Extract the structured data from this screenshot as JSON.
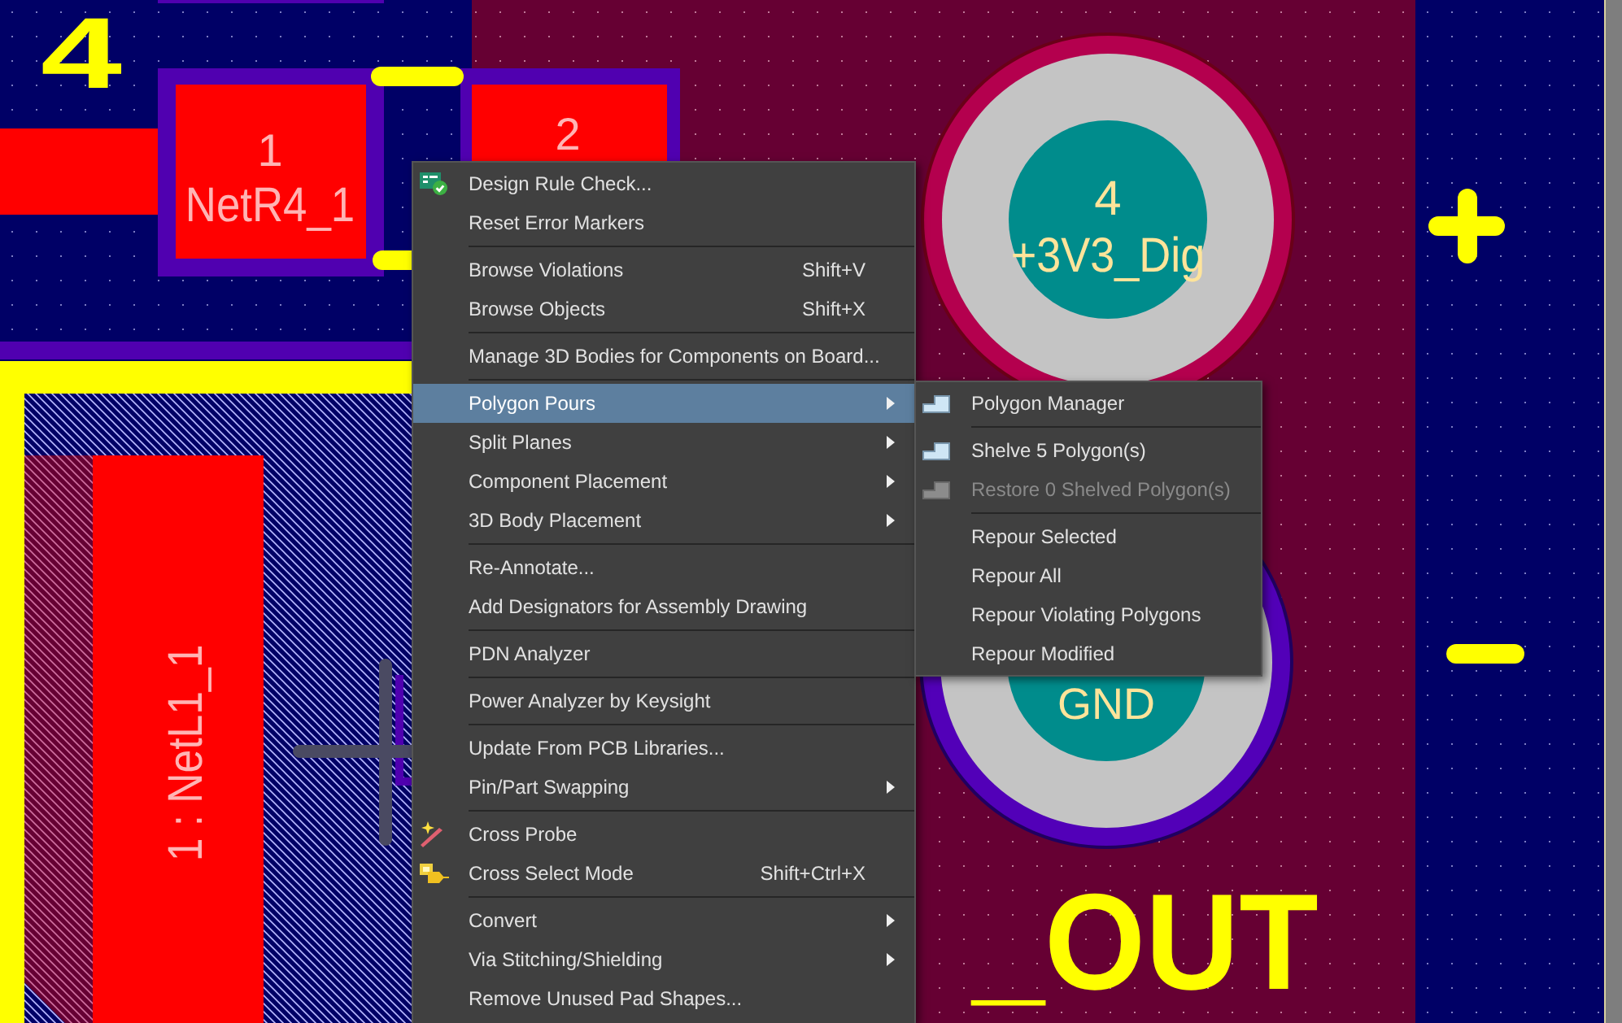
{
  "pcb": {
    "designator": "4",
    "silkscreen_label": "_OUT",
    "pads": [
      {
        "kind": "smd",
        "number": "1",
        "net": "NetR4_1"
      },
      {
        "kind": "smd",
        "number": "2"
      },
      {
        "kind": "smd-vertical",
        "label": "1 : NetL1_1"
      },
      {
        "kind": "through-hole",
        "number": "4",
        "net": "+3V3_Dig"
      },
      {
        "kind": "through-hole",
        "net": "GND"
      }
    ]
  },
  "context_menu": {
    "sections": [
      [
        {
          "label": "Design Rule Check...",
          "kind": "check",
          "submenu": false,
          "selected": false
        },
        {
          "label": "Reset Error Markers",
          "kind": "plain",
          "submenu": false,
          "selected": false
        }
      ],
      [
        {
          "label": "Browse Violations",
          "shortcut": "Shift+V",
          "kind": "plain",
          "submenu": false,
          "selected": false
        },
        {
          "label": "Browse Objects",
          "shortcut": "Shift+X",
          "kind": "plain",
          "submenu": false,
          "selected": false
        }
      ],
      [
        {
          "label": "Manage 3D Bodies for Components on Board...",
          "kind": "plain",
          "submenu": false,
          "selected": false
        }
      ],
      [
        {
          "label": "Polygon Pours",
          "kind": "plain",
          "submenu": true,
          "selected": true
        },
        {
          "label": "Split Planes",
          "kind": "plain",
          "submenu": true,
          "selected": false
        },
        {
          "label": "Component Placement",
          "kind": "plain",
          "submenu": true,
          "selected": false
        },
        {
          "label": "3D Body Placement",
          "kind": "plain",
          "submenu": true,
          "selected": false
        }
      ],
      [
        {
          "label": "Re-Annotate...",
          "kind": "plain",
          "submenu": false,
          "selected": false
        },
        {
          "label": "Add Designators for Assembly Drawing",
          "kind": "plain",
          "submenu": false,
          "selected": false
        }
      ],
      [
        {
          "label": "PDN Analyzer",
          "kind": "plain",
          "submenu": false,
          "selected": false
        }
      ],
      [
        {
          "label": "Power Analyzer by Keysight",
          "kind": "plain",
          "submenu": false,
          "selected": false
        }
      ],
      [
        {
          "label": "Update From PCB Libraries...",
          "kind": "plain",
          "submenu": false,
          "selected": false
        },
        {
          "label": "Pin/Part Swapping",
          "kind": "plain",
          "submenu": true,
          "selected": false
        }
      ],
      [
        {
          "label": "Cross Probe",
          "kind": "probe",
          "submenu": false,
          "selected": false
        },
        {
          "label": "Cross Select Mode",
          "shortcut": "Shift+Ctrl+X",
          "kind": "select",
          "submenu": false,
          "selected": false
        }
      ],
      [
        {
          "label": "Convert",
          "kind": "plain",
          "submenu": true,
          "selected": false
        },
        {
          "label": "Via Stitching/Shielding",
          "kind": "plain",
          "submenu": true,
          "selected": false
        },
        {
          "label": "Remove Unused Pad Shapes...",
          "kind": "plain",
          "submenu": false,
          "selected": false
        }
      ]
    ]
  },
  "submenu": {
    "sections": [
      [
        {
          "label": "Polygon Manager",
          "kind": "polygon",
          "disabled": false
        }
      ],
      [
        {
          "label": "Shelve 5 Polygon(s)",
          "kind": "polygon",
          "disabled": false
        },
        {
          "label": "Restore 0 Shelved Polygon(s)",
          "kind": "polygon",
          "disabled": true
        }
      ],
      [
        {
          "label": "Repour Selected",
          "kind": "plain",
          "disabled": false
        },
        {
          "label": "Repour All",
          "kind": "plain",
          "disabled": false
        },
        {
          "label": "Repour Violating Polygons",
          "kind": "plain",
          "disabled": false
        },
        {
          "label": "Repour Modified",
          "kind": "plain",
          "disabled": false
        }
      ]
    ]
  }
}
